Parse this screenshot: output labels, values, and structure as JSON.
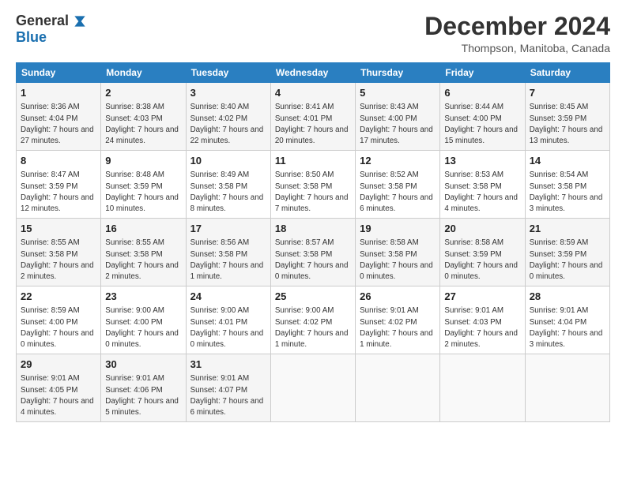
{
  "header": {
    "logo_general": "General",
    "logo_blue": "Blue",
    "month_title": "December 2024",
    "location": "Thompson, Manitoba, Canada"
  },
  "days_of_week": [
    "Sunday",
    "Monday",
    "Tuesday",
    "Wednesday",
    "Thursday",
    "Friday",
    "Saturday"
  ],
  "weeks": [
    [
      {
        "day": "1",
        "sunrise": "8:36 AM",
        "sunset": "4:04 PM",
        "daylight": "7 hours and 27 minutes."
      },
      {
        "day": "2",
        "sunrise": "8:38 AM",
        "sunset": "4:03 PM",
        "daylight": "7 hours and 24 minutes."
      },
      {
        "day": "3",
        "sunrise": "8:40 AM",
        "sunset": "4:02 PM",
        "daylight": "7 hours and 22 minutes."
      },
      {
        "day": "4",
        "sunrise": "8:41 AM",
        "sunset": "4:01 PM",
        "daylight": "7 hours and 20 minutes."
      },
      {
        "day": "5",
        "sunrise": "8:43 AM",
        "sunset": "4:00 PM",
        "daylight": "7 hours and 17 minutes."
      },
      {
        "day": "6",
        "sunrise": "8:44 AM",
        "sunset": "4:00 PM",
        "daylight": "7 hours and 15 minutes."
      },
      {
        "day": "7",
        "sunrise": "8:45 AM",
        "sunset": "3:59 PM",
        "daylight": "7 hours and 13 minutes."
      }
    ],
    [
      {
        "day": "8",
        "sunrise": "8:47 AM",
        "sunset": "3:59 PM",
        "daylight": "7 hours and 12 minutes."
      },
      {
        "day": "9",
        "sunrise": "8:48 AM",
        "sunset": "3:59 PM",
        "daylight": "7 hours and 10 minutes."
      },
      {
        "day": "10",
        "sunrise": "8:49 AM",
        "sunset": "3:58 PM",
        "daylight": "7 hours and 8 minutes."
      },
      {
        "day": "11",
        "sunrise": "8:50 AM",
        "sunset": "3:58 PM",
        "daylight": "7 hours and 7 minutes."
      },
      {
        "day": "12",
        "sunrise": "8:52 AM",
        "sunset": "3:58 PM",
        "daylight": "7 hours and 6 minutes."
      },
      {
        "day": "13",
        "sunrise": "8:53 AM",
        "sunset": "3:58 PM",
        "daylight": "7 hours and 4 minutes."
      },
      {
        "day": "14",
        "sunrise": "8:54 AM",
        "sunset": "3:58 PM",
        "daylight": "7 hours and 3 minutes."
      }
    ],
    [
      {
        "day": "15",
        "sunrise": "8:55 AM",
        "sunset": "3:58 PM",
        "daylight": "7 hours and 2 minutes."
      },
      {
        "day": "16",
        "sunrise": "8:55 AM",
        "sunset": "3:58 PM",
        "daylight": "7 hours and 2 minutes."
      },
      {
        "day": "17",
        "sunrise": "8:56 AM",
        "sunset": "3:58 PM",
        "daylight": "7 hours and 1 minute."
      },
      {
        "day": "18",
        "sunrise": "8:57 AM",
        "sunset": "3:58 PM",
        "daylight": "7 hours and 0 minutes."
      },
      {
        "day": "19",
        "sunrise": "8:58 AM",
        "sunset": "3:58 PM",
        "daylight": "7 hours and 0 minutes."
      },
      {
        "day": "20",
        "sunrise": "8:58 AM",
        "sunset": "3:59 PM",
        "daylight": "7 hours and 0 minutes."
      },
      {
        "day": "21",
        "sunrise": "8:59 AM",
        "sunset": "3:59 PM",
        "daylight": "7 hours and 0 minutes."
      }
    ],
    [
      {
        "day": "22",
        "sunrise": "8:59 AM",
        "sunset": "4:00 PM",
        "daylight": "7 hours and 0 minutes."
      },
      {
        "day": "23",
        "sunrise": "9:00 AM",
        "sunset": "4:00 PM",
        "daylight": "7 hours and 0 minutes."
      },
      {
        "day": "24",
        "sunrise": "9:00 AM",
        "sunset": "4:01 PM",
        "daylight": "7 hours and 0 minutes."
      },
      {
        "day": "25",
        "sunrise": "9:00 AM",
        "sunset": "4:02 PM",
        "daylight": "7 hours and 1 minute."
      },
      {
        "day": "26",
        "sunrise": "9:01 AM",
        "sunset": "4:02 PM",
        "daylight": "7 hours and 1 minute."
      },
      {
        "day": "27",
        "sunrise": "9:01 AM",
        "sunset": "4:03 PM",
        "daylight": "7 hours and 2 minutes."
      },
      {
        "day": "28",
        "sunrise": "9:01 AM",
        "sunset": "4:04 PM",
        "daylight": "7 hours and 3 minutes."
      }
    ],
    [
      {
        "day": "29",
        "sunrise": "9:01 AM",
        "sunset": "4:05 PM",
        "daylight": "7 hours and 4 minutes."
      },
      {
        "day": "30",
        "sunrise": "9:01 AM",
        "sunset": "4:06 PM",
        "daylight": "7 hours and 5 minutes."
      },
      {
        "day": "31",
        "sunrise": "9:01 AM",
        "sunset": "4:07 PM",
        "daylight": "7 hours and 6 minutes."
      },
      null,
      null,
      null,
      null
    ]
  ]
}
